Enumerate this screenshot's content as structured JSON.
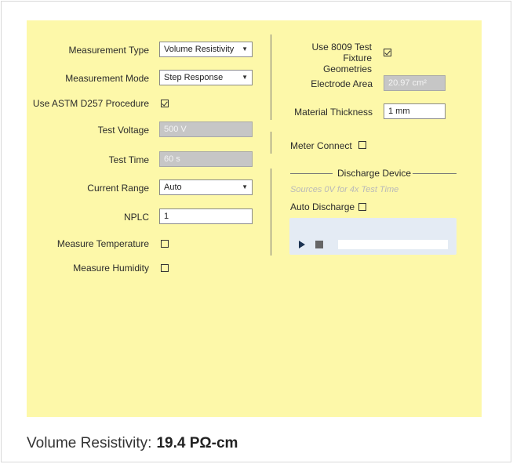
{
  "left": {
    "measurement_type": {
      "label": "Measurement Type",
      "value": "Volume Resistivity"
    },
    "measurement_mode": {
      "label": "Measurement Mode",
      "value": "Step Response"
    },
    "astm": {
      "label": "Use ASTM D257 Procedure",
      "checked": true
    },
    "test_voltage": {
      "label": "Test Voltage",
      "value": "500 V"
    },
    "test_time": {
      "label": "Test Time",
      "value": "60 s"
    },
    "current_range": {
      "label": "Current Range",
      "value": "Auto"
    },
    "nplc": {
      "label": "NPLC",
      "value": "1"
    },
    "measure_temperature": {
      "label": "Measure Temperature",
      "checked": false
    },
    "measure_humidity": {
      "label": "Measure Humidity",
      "checked": false
    }
  },
  "right": {
    "fixture": {
      "label_line1": "Use 8009 Test Fixture",
      "label_line2": "Geometries",
      "checked": true
    },
    "electrode_area": {
      "label": "Electrode Area",
      "value": "20.97 cm²"
    },
    "material_thickness": {
      "label": "Material Thickness",
      "value": "1 mm"
    },
    "meter_connect": {
      "label": "Meter Connect",
      "checked": false
    },
    "discharge": {
      "title": "Discharge Device",
      "hint": "Sources 0V for 4x Test Time",
      "auto_label": "Auto Discharge",
      "auto_checked": false
    },
    "player": {
      "progress": 0
    }
  },
  "result": {
    "label": "Volume Resistivity:",
    "value": "19.4 PΩ-cm"
  },
  "colors": {
    "panel": "#fdf8a9",
    "disabled": "#c6c6c6",
    "player": "#e4ebf4",
    "play": "#1c3352"
  },
  "icons": {
    "dropdown": "caret-down-icon",
    "play": "play-icon",
    "stop": "stop-icon",
    "check": "checkmark-icon"
  }
}
